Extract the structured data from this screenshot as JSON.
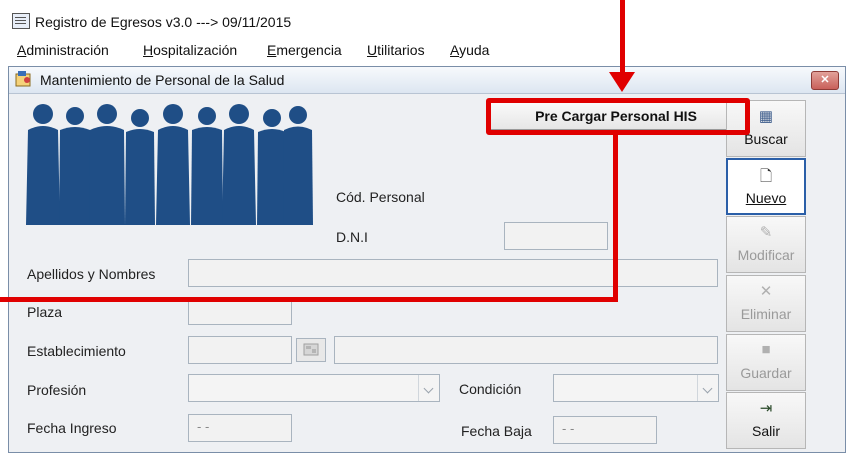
{
  "app": {
    "title": "Registro de Egresos v3.0  ---> 09/11/2015"
  },
  "menu": [
    {
      "first": "A",
      "rest": "dministración"
    },
    {
      "first": "H",
      "rest": "ospitalización"
    },
    {
      "first": "E",
      "rest": "mergencia"
    },
    {
      "first": "U",
      "rest": "tilitarios"
    },
    {
      "first": "A",
      "rest": "yuda"
    }
  ],
  "frame": {
    "title": "Mantenimiento de Personal de la Salud",
    "close_glyph": "✕"
  },
  "form": {
    "precargar_label": "Pre Cargar Personal HIS",
    "cod_personal_label": "Cód. Personal",
    "dni_label": "D.N.I",
    "apellidos_label": "Apellidos y Nombres",
    "plaza_label": "Plaza",
    "establecimiento_label": "Establecimiento",
    "profesion_label": "Profesión",
    "condicion_label": "Condición",
    "fecha_ingreso_label": "Fecha Ingreso",
    "fecha_ingreso_value": "- -",
    "fecha_baja_label": "Fecha Baja",
    "fecha_baja_value": "- -"
  },
  "toolbar": {
    "buscar": {
      "label": "Buscar",
      "icon": "search-icon",
      "enabled": true
    },
    "nuevo": {
      "label": "Nuevo",
      "icon": "new-document-icon",
      "enabled": true
    },
    "modificar": {
      "label": "Modificar",
      "icon": "edit-icon",
      "enabled": false
    },
    "eliminar": {
      "label": "Eliminar",
      "icon": "delete-icon",
      "enabled": false
    },
    "guardar": {
      "label": "Guardar",
      "icon": "save-icon",
      "enabled": false
    },
    "salir": {
      "label": "Salir",
      "icon": "exit-icon",
      "enabled": true
    }
  },
  "colors": {
    "annotation": "#e00000",
    "silhouette": "#1f4e86",
    "focus_border": "#2b5fa8"
  }
}
